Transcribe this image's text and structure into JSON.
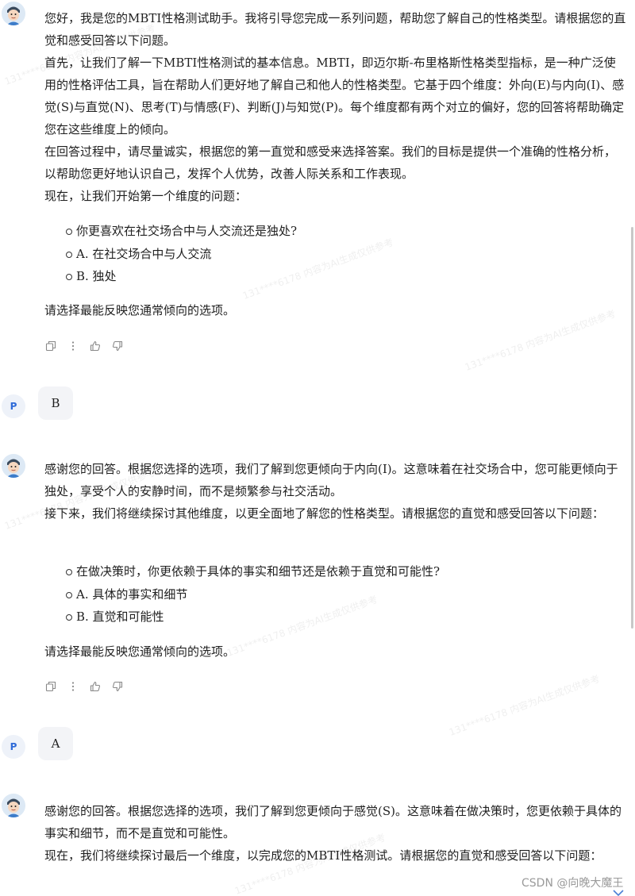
{
  "messages": [
    {
      "role": "bot",
      "paragraphs": [
        "您好，我是您的MBTI性格测试助手。我将引导您完成一系列问题，帮助您了解自己的性格类型。请根据您的直觉和感受回答以下问题。",
        "首先，让我们了解一下MBTI性格测试的基本信息。MBTI，即迈尔斯-布里格斯性格类型指标，是一种广泛使用的性格评估工具，旨在帮助人们更好地了解自己和他人的性格类型。它基于四个维度：外向(E)与内向(I)、感觉(S)与直觉(N)、思考(T)与情感(F)、判断(J)与知觉(P)。每个维度都有两个对立的偏好，您的回答将帮助确定您在这些维度上的倾向。",
        "在回答过程中，请尽量诚实，根据您的第一直觉和感受来选择答案。我们的目标是提供一个准确的性格分析，以帮助您更好地认识自己，发挥个人优势，改善人际关系和工作表现。",
        "现在，让我们开始第一个维度的问题："
      ],
      "bullets": [
        "你更喜欢在社交场合中与人交流还是独处?",
        "A. 在社交场合中与人交流",
        "B. 独处"
      ],
      "closing": "请选择最能反映您通常倾向的选项。"
    },
    {
      "role": "user",
      "avatar_letter": "P",
      "text": "B"
    },
    {
      "role": "bot",
      "paragraphs": [
        "感谢您的回答。根据您选择的选项，我们了解到您更倾向于内向(I)。这意味着在社交场合中，您可能更倾向于独处，享受个人的安静时间，而不是频繁参与社交活动。",
        "接下来，我们将继续探讨其他维度，以更全面地了解您的性格类型。请根据您的直觉和感受回答以下问题："
      ],
      "bullets": [
        "在做决策时，你更依赖于具体的事实和细节还是依赖于直觉和可能性?",
        "A. 具体的事实和细节",
        "B. 直觉和可能性"
      ],
      "closing": "请选择最能反映您通常倾向的选项。"
    },
    {
      "role": "user",
      "avatar_letter": "P",
      "text": "A"
    },
    {
      "role": "bot",
      "paragraphs": [
        "感谢您的回答。根据您选择的选项，我们了解到您更倾向于感觉(S)。这意味着在做决策时，您更依赖于具体的事实和细节，而不是直觉和可能性。",
        "现在，我们将继续探讨最后一个维度，以完成您的MBTI性格测试。请根据您的直觉和感受回答以下问题："
      ]
    }
  ],
  "watermark": "CSDN @向晚大魔王",
  "bg_watermark": "131****6178 内容为AI生成仅供参考",
  "icons": [
    "copy-icon",
    "more-icon",
    "thumbs-up-icon",
    "thumbs-down-icon",
    "scroll-down-icon"
  ]
}
